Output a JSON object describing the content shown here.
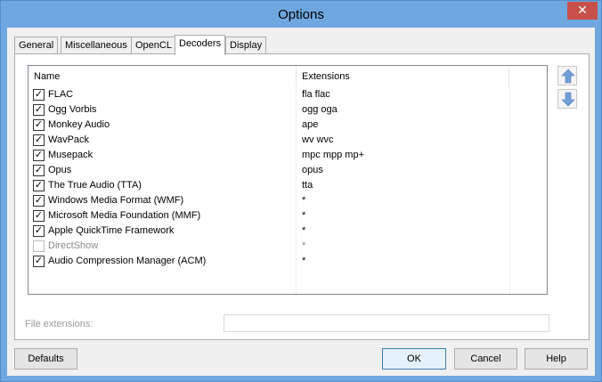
{
  "window": {
    "title": "Options",
    "close_glyph": "✕"
  },
  "tabs": [
    {
      "label": "General"
    },
    {
      "label": "Miscellaneous"
    },
    {
      "label": "OpenCL"
    },
    {
      "label": "Decoders"
    },
    {
      "label": "Display"
    }
  ],
  "active_tab": "Decoders",
  "decoders": {
    "columns": {
      "name": "Name",
      "extensions": "Extensions"
    },
    "rows": [
      {
        "name": "FLAC",
        "ext": "fla flac",
        "checked": true
      },
      {
        "name": "Ogg Vorbis",
        "ext": "ogg oga",
        "checked": true
      },
      {
        "name": "Monkey Audio",
        "ext": "ape",
        "checked": true
      },
      {
        "name": "WavPack",
        "ext": "wv wvc",
        "checked": true
      },
      {
        "name": "Musepack",
        "ext": "mpc mpp mp+",
        "checked": true
      },
      {
        "name": "Opus",
        "ext": "opus",
        "checked": true
      },
      {
        "name": "The True Audio (TTA)",
        "ext": "tta",
        "checked": true
      },
      {
        "name": "Windows Media Format (WMF)",
        "ext": "*",
        "checked": true
      },
      {
        "name": "Microsoft Media Foundation (MMF)",
        "ext": "*",
        "checked": true
      },
      {
        "name": "Apple QuickTime Framework",
        "ext": "*",
        "checked": true
      },
      {
        "name": "DirectShow",
        "ext": "*",
        "checked": false
      },
      {
        "name": "Audio Compression Manager (ACM)",
        "ext": "*",
        "checked": true
      }
    ],
    "move_up_icon": "arrow-up-icon",
    "move_down_icon": "arrow-down-icon"
  },
  "file_extensions": {
    "label": "File extensions:",
    "value": ""
  },
  "buttons": {
    "defaults": "Defaults",
    "ok": "OK",
    "cancel": "Cancel",
    "help": "Help"
  },
  "colors": {
    "title_bar": "#6fa8e0",
    "close_button": "#c7504b",
    "arrow": "#6f9fd6"
  }
}
